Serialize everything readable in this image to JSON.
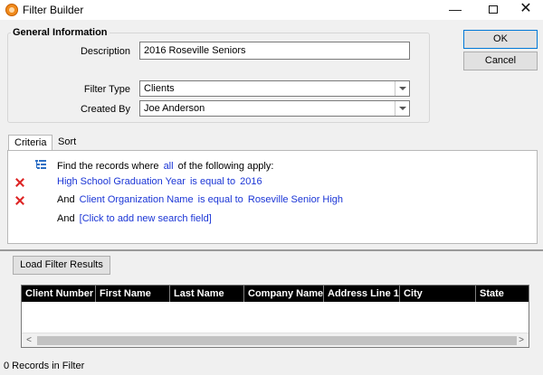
{
  "window": {
    "title": "Filter Builder",
    "minimize": "—",
    "maximize": "",
    "close": "✕"
  },
  "general": {
    "legend": "General Information",
    "description_label": "Description",
    "description_value": "2016 Roseville Seniors",
    "filter_type_label": "Filter Type",
    "filter_type_value": "Clients",
    "created_by_label": "Created By",
    "created_by_value": "Joe Anderson"
  },
  "buttons": {
    "ok": "OK",
    "cancel": "Cancel",
    "load": "Load Filter Results"
  },
  "tabs": [
    {
      "label": "Criteria"
    },
    {
      "label": "Sort"
    }
  ],
  "criteria": {
    "intro_prefix": "Find the records where",
    "intro_link": "all",
    "intro_suffix": "of the following apply:",
    "rows": [
      {
        "and": "",
        "field": "High School Graduation Year",
        "operator": "is equal to",
        "value": "2016"
      },
      {
        "and": "And",
        "field": "Client Organization Name",
        "operator": "is equal to",
        "value": "Roseville Senior High"
      }
    ],
    "add_and": "And",
    "add_link": "[Click to add new search field]"
  },
  "grid": {
    "columns": [
      "Client Number",
      "First Name",
      "Last Name",
      "Company Name",
      "Address Line 1",
      "City",
      "State"
    ],
    "scroll_left": "<",
    "scroll_right": ">"
  },
  "status": {
    "text": "0 Records in Filter"
  }
}
